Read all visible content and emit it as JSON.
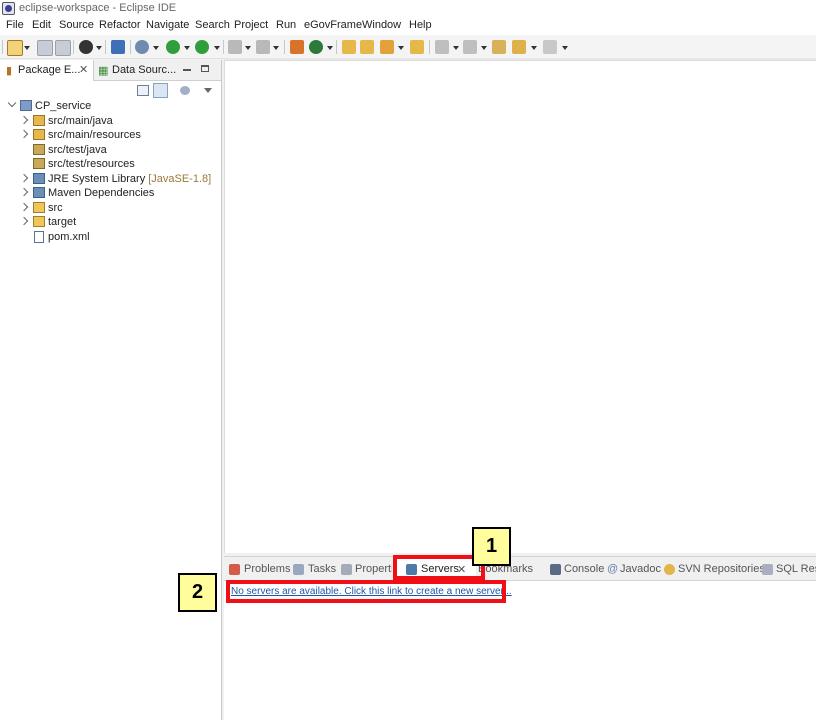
{
  "window": {
    "title": "eclipse-workspace - Eclipse IDE"
  },
  "menu": [
    "File",
    "Edit",
    "Source",
    "Refactor",
    "Navigate",
    "Search",
    "Project",
    "Run",
    "eGovFrame",
    "Window",
    "Help"
  ],
  "left_tabs": {
    "package_explorer": "Package E...",
    "data_source": "Data Sourc..."
  },
  "tree": {
    "project": "CP_service",
    "items": [
      {
        "label": "src/main/java"
      },
      {
        "label": "src/main/resources"
      },
      {
        "label": "src/test/java"
      },
      {
        "label": "src/test/resources"
      },
      {
        "label": "JRE System Library",
        "decor": "[JavaSE-1.8]"
      },
      {
        "label": "Maven Dependencies"
      },
      {
        "label": "src"
      },
      {
        "label": "target"
      },
      {
        "label": "pom.xml"
      }
    ]
  },
  "bottom_tabs": [
    "Problems",
    "Tasks",
    "Properties",
    "Servers",
    "Bookmarks",
    "Console",
    "Javadoc",
    "SVN Repositories",
    "SQL Resu"
  ],
  "servers": {
    "link": "No servers are available. Click this link to create a new server..."
  },
  "callouts": {
    "one": "1",
    "two": "2"
  },
  "colors": {
    "highlight": "#f00f17",
    "callout_bg": "#fffd9c",
    "link": "#1f56a8"
  }
}
